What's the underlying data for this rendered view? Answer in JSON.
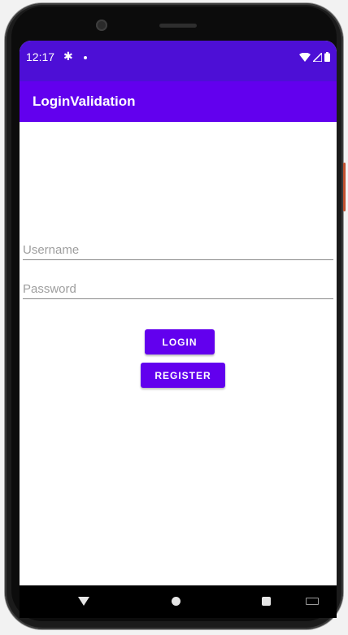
{
  "status_bar": {
    "time": "12:17",
    "settings_icon": "gear-icon",
    "notification_icon": "dot-icon",
    "wifi_icon": "wifi-icon",
    "signal_icon": "cell-signal-icon",
    "battery_icon": "battery-icon"
  },
  "app_bar": {
    "title": "LoginValidation"
  },
  "form": {
    "username": {
      "value": "",
      "placeholder": "Username"
    },
    "password": {
      "value": "",
      "placeholder": "Password"
    },
    "login_label": "LOGIN",
    "register_label": "REGISTER"
  },
  "nav_bar": {
    "back_icon": "triangle-back-icon",
    "home_icon": "circle-home-icon",
    "recents_icon": "square-recents-icon",
    "keyboard_icon": "keyboard-icon"
  },
  "colors": {
    "status_bar": "#4d0fd6",
    "app_bar": "#6200ee",
    "button": "#6200ee"
  }
}
